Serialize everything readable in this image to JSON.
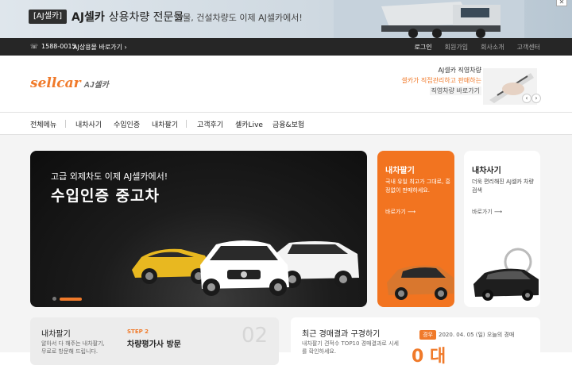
{
  "top_banner": {
    "badge": "[AJ셀카]",
    "brand_bold": "AJ셀카",
    "brand_rest": "상용차량 전문몰",
    "subtitle": "화물, 건설차량도 이제 AJ셀카에서!",
    "close_icon": "close-icon"
  },
  "utility_bar": {
    "phone": "1588-0015",
    "shortcut": "AJ상용몰 바로가기",
    "links": [
      "로그인",
      "회원가입",
      "회사소개",
      "고객센터"
    ]
  },
  "header": {
    "logo_text": "sellcar",
    "logo_sub": "AJ셀카",
    "promo": {
      "line1": "AJ셀카 직영차량",
      "line2": "셀카가 직접관리하고 판매하는",
      "line3": "직영차량 바로가기"
    }
  },
  "nav": {
    "items": [
      "전체메뉴",
      "내차사기",
      "수입인증",
      "내차팔기",
      "고객후기",
      "셀카Live",
      "금융&보험"
    ]
  },
  "hero": {
    "small": "고급 외제차도 이제 AJ셀카에서!",
    "big": "수입인증 중고차"
  },
  "sell_card": {
    "title": "내차팔기",
    "desc": "국내 유일 최고가 그대로, 흥정없이 판매하세요.",
    "more": "바로가기"
  },
  "buy_card": {
    "title": "내차사기",
    "desc": "더욱 편리해진 AJ셀카 차량 검색",
    "more": "바로가기"
  },
  "step_card": {
    "title": "내차팔기",
    "desc": "알아서 다 해주는 내차팔기, 무료로 방문해 드립니다.",
    "step": "STEP 2",
    "step_title": "차량평가사 방문",
    "number": "02"
  },
  "auction_card": {
    "title": "최근 경매결과 구경하기",
    "desc": "내차팔기 견적수 TOP10 경매결과로 시세를 확인하세요.",
    "badge": "경우",
    "date": "2020. 04. 05 (일) 오늘의 경매",
    "big": "0 대"
  },
  "colors": {
    "accent": "#f27420",
    "dark": "#262626"
  }
}
